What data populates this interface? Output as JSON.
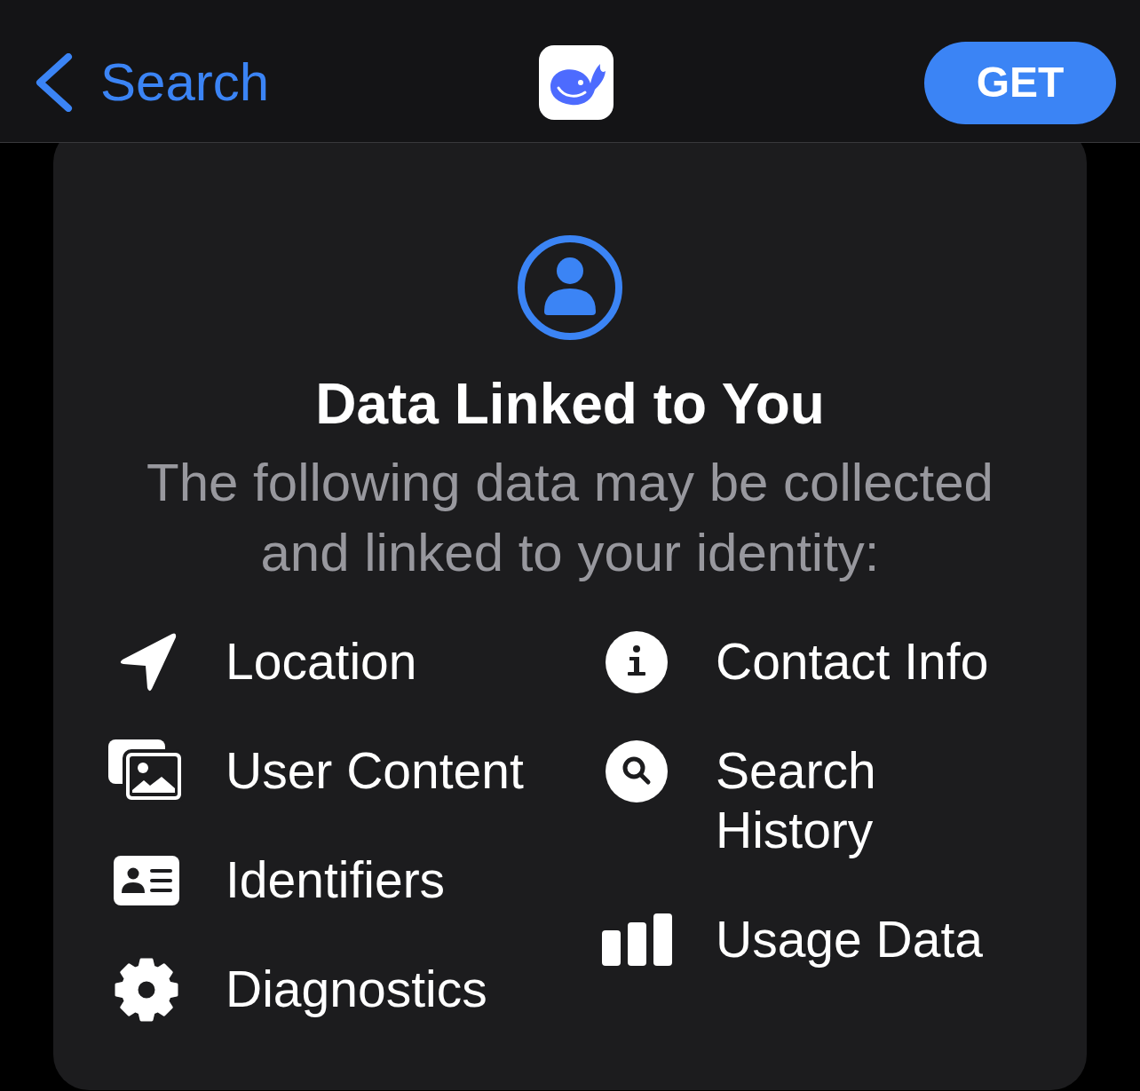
{
  "nav": {
    "back_label": "Search",
    "action_label": "GET"
  },
  "privacy_card": {
    "title": "Data Linked to You",
    "description": "The following data may be collected and linked to your identity:",
    "left_column": [
      "Location",
      "User Content",
      "Identifiers",
      "Diagnostics"
    ],
    "right_column": [
      "Contact Info",
      "Search History",
      "Usage Data"
    ]
  }
}
